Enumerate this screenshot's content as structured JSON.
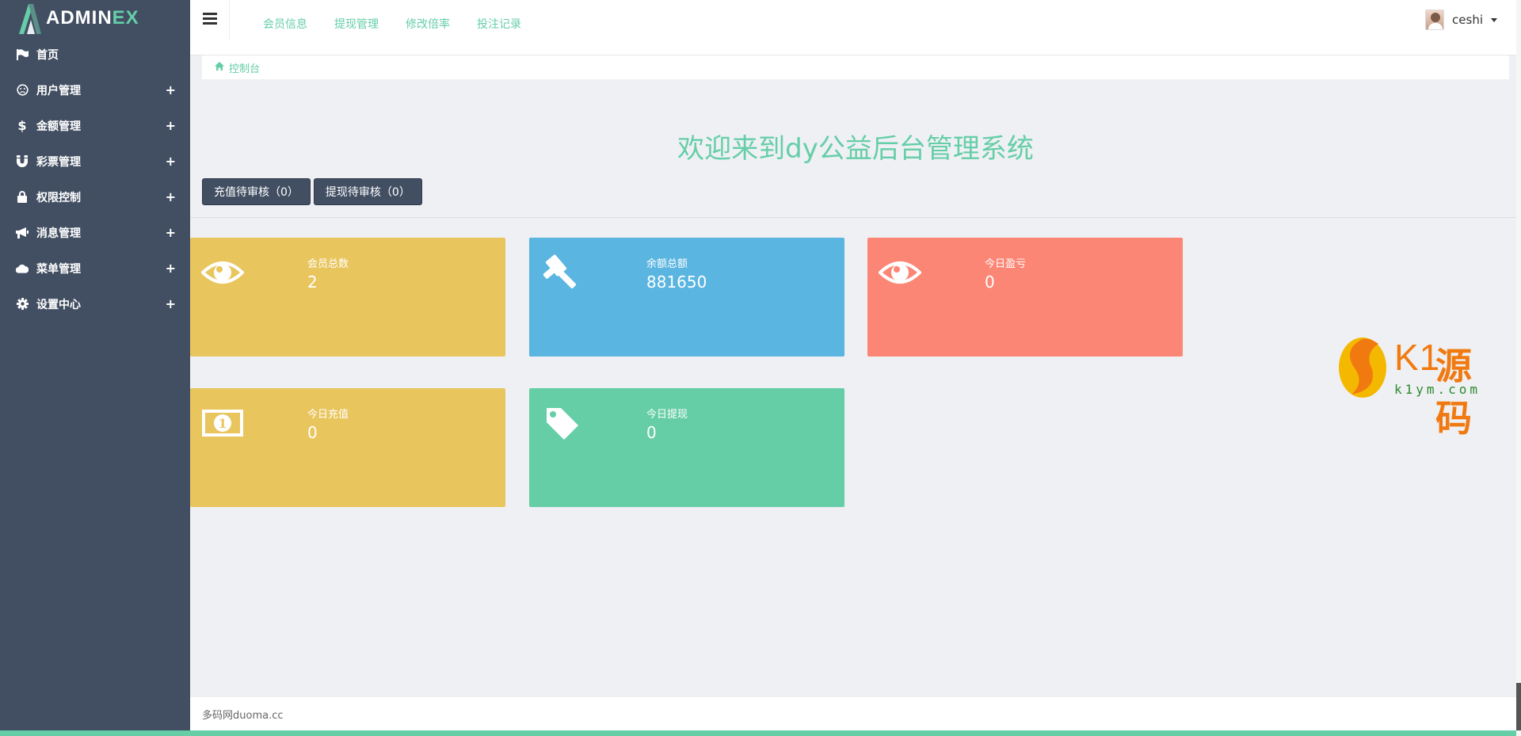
{
  "brand": {
    "name_main": "ADMIN",
    "name_accent": "EX"
  },
  "sidebar": {
    "items": [
      {
        "label": "首页",
        "icon": "flag-icon",
        "expand": ""
      },
      {
        "label": "用户管理",
        "icon": "face-icon",
        "expand": "+"
      },
      {
        "label": "金额管理",
        "icon": "dollar-icon",
        "expand": "+"
      },
      {
        "label": "彩票管理",
        "icon": "magnet-icon",
        "expand": "+"
      },
      {
        "label": "权限控制",
        "icon": "lock-icon",
        "expand": "+"
      },
      {
        "label": "消息管理",
        "icon": "bullhorn-icon",
        "expand": "+"
      },
      {
        "label": "菜单管理",
        "icon": "cloud-icon",
        "expand": "+"
      },
      {
        "label": "设置中心",
        "icon": "gear-icon",
        "expand": "+"
      }
    ]
  },
  "header": {
    "links": [
      "会员信息",
      "提现管理",
      "修改倍率",
      "投注记录"
    ],
    "username": "ceshi"
  },
  "breadcrumb": {
    "label": "控制台"
  },
  "main": {
    "welcome": "欢迎来到dy公益后台管理系统",
    "pending": [
      {
        "label": "充值待审核（0）"
      },
      {
        "label": "提现待审核（0）"
      }
    ],
    "cards": [
      {
        "title": "会员总数",
        "value": "2",
        "icon": "eye-icon",
        "color": "#e9c55e"
      },
      {
        "title": "余额总额",
        "value": "881650",
        "icon": "gavel-icon",
        "color": "#5ab5e0"
      },
      {
        "title": "今日盈亏",
        "value": "0",
        "icon": "eye-icon",
        "color": "#fc8675"
      },
      {
        "title": "今日充值",
        "value": "0",
        "icon": "money-icon",
        "color": "#e9c55e"
      },
      {
        "title": "今日提现",
        "value": "0",
        "icon": "tag-icon",
        "color": "#65cea7"
      }
    ]
  },
  "watermark": {
    "k1": "K1",
    "cn": "源码",
    "url": "k1ym.com"
  },
  "footer": {
    "text": "多码网duoma.cc"
  },
  "colors": {
    "sidebar": "#424f63",
    "accent": "#65cea7"
  }
}
